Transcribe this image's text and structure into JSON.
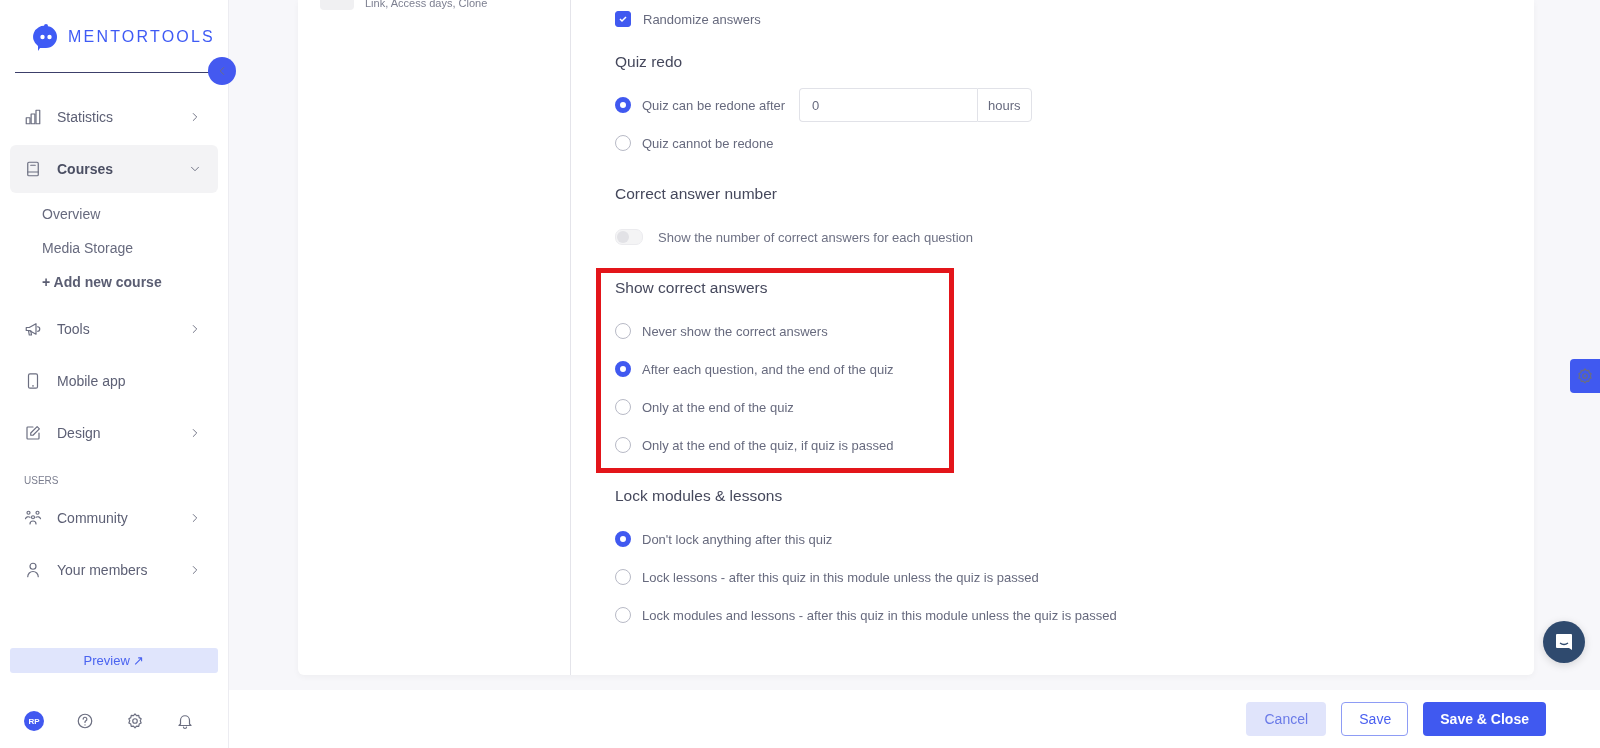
{
  "sidebar": {
    "logo": "MENTORTOOLS",
    "nav": [
      {
        "kind": "item",
        "label": "Statistics",
        "selected": false,
        "expanded": false
      },
      {
        "kind": "item",
        "label": "Courses",
        "selected": true,
        "expanded": true
      },
      {
        "kind": "sub",
        "label": "Overview"
      },
      {
        "kind": "sub",
        "label": "Media Storage"
      },
      {
        "kind": "action",
        "label": "+ Add new course"
      },
      {
        "kind": "item",
        "label": "Tools",
        "selected": false,
        "expanded": false
      },
      {
        "kind": "item",
        "label": "Mobile app",
        "selected": false
      },
      {
        "kind": "item",
        "label": "Design",
        "selected": false,
        "expanded": false
      },
      {
        "kind": "section",
        "label": "USERS"
      },
      {
        "kind": "item",
        "label": "Community",
        "selected": false,
        "expanded": false
      },
      {
        "kind": "item",
        "label": "Your members",
        "selected": false,
        "expanded": false
      }
    ],
    "preview": "Preview ↗",
    "avatar": "RP"
  },
  "left_panel": {
    "item_subtitle": "Link, Access days, Clone"
  },
  "quiz_settings": {
    "randomize": {
      "label": "Randomize answers",
      "checked": true
    },
    "sections": [
      {
        "heading": "Quiz redo",
        "highlighted": false,
        "options": [
          {
            "kind": "radio",
            "label": "Quiz can be redone after",
            "selected": true,
            "input": {
              "value": "0",
              "suffix": "hours"
            }
          },
          {
            "kind": "radio",
            "label": "Quiz cannot be redone",
            "selected": false
          }
        ]
      },
      {
        "heading": "Correct answer number",
        "highlighted": false,
        "options": [
          {
            "kind": "toggle",
            "label": "Show the number of correct answers for each question",
            "on": false,
            "disabled": true
          }
        ]
      },
      {
        "heading": "Show correct answers",
        "highlighted": true,
        "options": [
          {
            "kind": "radio",
            "label": "Never show the correct answers",
            "selected": false
          },
          {
            "kind": "radio",
            "label": "After each question, and the end of the quiz",
            "selected": true
          },
          {
            "kind": "radio",
            "label": "Only at the end of the quiz",
            "selected": false
          },
          {
            "kind": "radio",
            "label": "Only at the end of the quiz, if quiz is passed",
            "selected": false
          }
        ]
      },
      {
        "heading": "Lock modules & lessons",
        "highlighted": false,
        "options": [
          {
            "kind": "radio",
            "label": "Don't lock anything after this quiz",
            "selected": true
          },
          {
            "kind": "radio",
            "label": "Lock lessons - after this quiz in this module unless the quiz is passed",
            "selected": false
          },
          {
            "kind": "radio",
            "label": "Lock modules and lessons - after this quiz in this module unless the quiz is passed",
            "selected": false
          }
        ]
      }
    ]
  },
  "footer": {
    "buttons": [
      {
        "kind": "cancel",
        "label": "Cancel"
      },
      {
        "kind": "secondary",
        "label": "Save"
      },
      {
        "kind": "primary",
        "label": "Save & Close"
      }
    ]
  }
}
